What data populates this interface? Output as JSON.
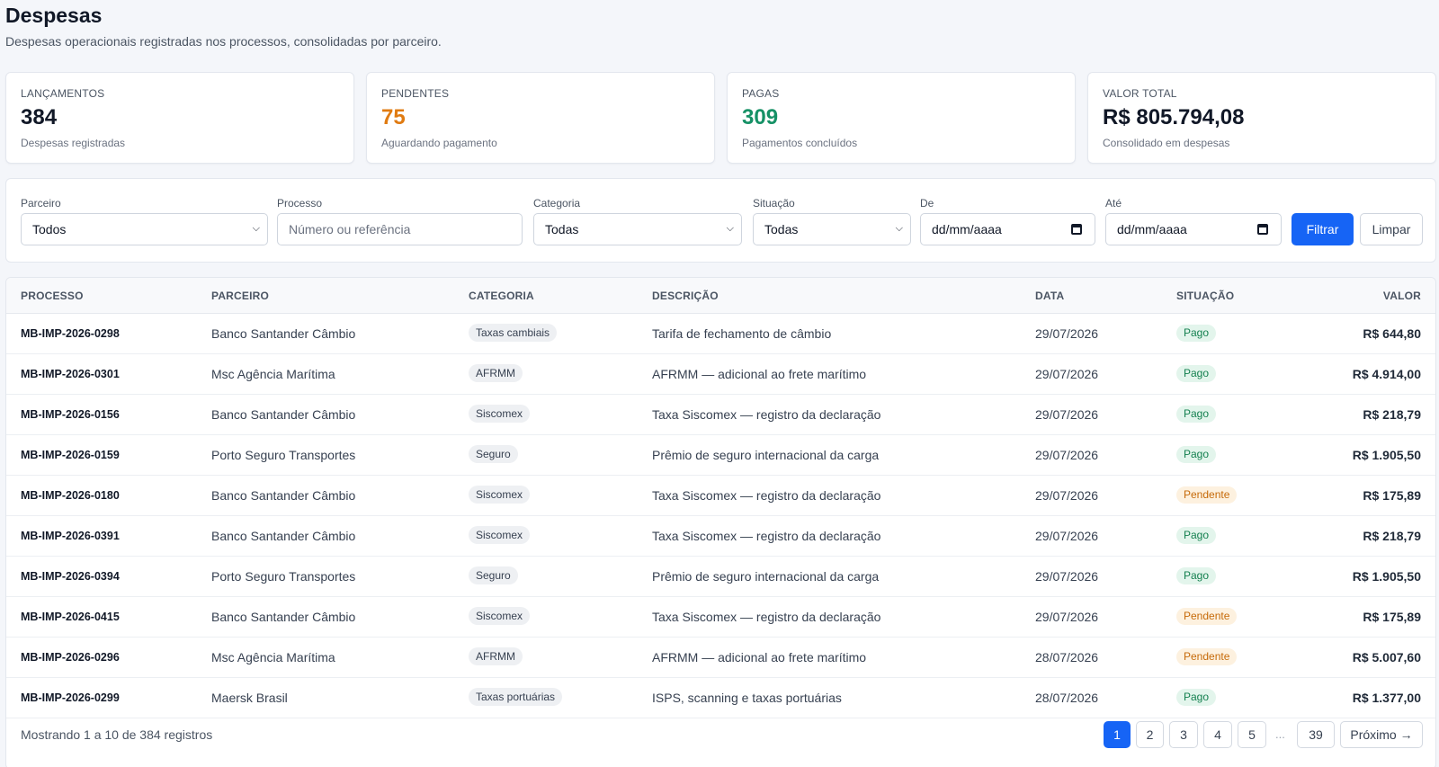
{
  "header": {
    "title": "Despesas",
    "subtitle": "Despesas operacionais registradas nos processos, consolidadas por parceiro."
  },
  "stats": [
    {
      "label": "LANÇAMENTOS",
      "value": "384",
      "hint": "Despesas registradas"
    },
    {
      "label": "PENDENTES",
      "value": "75",
      "hint": "Aguardando pagamento"
    },
    {
      "label": "PAGAS",
      "value": "309",
      "hint": "Pagamentos concluídos"
    },
    {
      "label": "VALOR TOTAL",
      "value": "R$ 805.794,08",
      "hint": "Consolidado em despesas"
    }
  ],
  "colors": {
    "accent": "#1664f5",
    "pending": "#e07b12",
    "paid": "#169166"
  },
  "filters": {
    "parceiro": {
      "label": "Parceiro",
      "value": "Todos"
    },
    "processo": {
      "label": "Processo",
      "placeholder": "Número ou referência"
    },
    "categoria": {
      "label": "Categoria",
      "value": "Todas"
    },
    "situacao": {
      "label": "Situação",
      "value": "Todas"
    },
    "de": {
      "label": "De",
      "value": "dd/mm/aaaa"
    },
    "ate": {
      "label": "Até",
      "value": "dd/mm/aaaa"
    },
    "filter_button": "Filtrar",
    "clear_button": "Limpar"
  },
  "table": {
    "columns": [
      "PROCESSO",
      "PARCEIRO",
      "CATEGORIA",
      "DESCRIÇÃO",
      "DATA",
      "SITUAÇÃO",
      "VALOR"
    ],
    "rows": [
      {
        "processo": "MB-IMP-2026-0298",
        "parceiro": "Banco Santander Câmbio",
        "categoria": "Taxas cambiais",
        "descricao": "Tarifa de fechamento de câmbio",
        "data": "29/07/2026",
        "situacao": "Pago",
        "valor": "R$ 644,80"
      },
      {
        "processo": "MB-IMP-2026-0301",
        "parceiro": "Msc Agência Marítima",
        "categoria": "AFRMM",
        "descricao": "AFRMM — adicional ao frete marítimo",
        "data": "29/07/2026",
        "situacao": "Pago",
        "valor": "R$ 4.914,00"
      },
      {
        "processo": "MB-IMP-2026-0156",
        "parceiro": "Banco Santander Câmbio",
        "categoria": "Siscomex",
        "descricao": "Taxa Siscomex — registro da declaração",
        "data": "29/07/2026",
        "situacao": "Pago",
        "valor": "R$ 218,79"
      },
      {
        "processo": "MB-IMP-2026-0159",
        "parceiro": "Porto Seguro Transportes",
        "categoria": "Seguro",
        "descricao": "Prêmio de seguro internacional da carga",
        "data": "29/07/2026",
        "situacao": "Pago",
        "valor": "R$ 1.905,50"
      },
      {
        "processo": "MB-IMP-2026-0180",
        "parceiro": "Banco Santander Câmbio",
        "categoria": "Siscomex",
        "descricao": "Taxa Siscomex — registro da declaração",
        "data": "29/07/2026",
        "situacao": "Pendente",
        "valor": "R$ 175,89"
      },
      {
        "processo": "MB-IMP-2026-0391",
        "parceiro": "Banco Santander Câmbio",
        "categoria": "Siscomex",
        "descricao": "Taxa Siscomex — registro da declaração",
        "data": "29/07/2026",
        "situacao": "Pago",
        "valor": "R$ 218,79"
      },
      {
        "processo": "MB-IMP-2026-0394",
        "parceiro": "Porto Seguro Transportes",
        "categoria": "Seguro",
        "descricao": "Prêmio de seguro internacional da carga",
        "data": "29/07/2026",
        "situacao": "Pago",
        "valor": "R$ 1.905,50"
      },
      {
        "processo": "MB-IMP-2026-0415",
        "parceiro": "Banco Santander Câmbio",
        "categoria": "Siscomex",
        "descricao": "Taxa Siscomex — registro da declaração",
        "data": "29/07/2026",
        "situacao": "Pendente",
        "valor": "R$ 175,89"
      },
      {
        "processo": "MB-IMP-2026-0296",
        "parceiro": "Msc Agência Marítima",
        "categoria": "AFRMM",
        "descricao": "AFRMM — adicional ao frete marítimo",
        "data": "28/07/2026",
        "situacao": "Pendente",
        "valor": "R$ 5.007,60"
      },
      {
        "processo": "MB-IMP-2026-0299",
        "parceiro": "Maersk Brasil",
        "categoria": "Taxas portuárias",
        "descricao": "ISPS, scanning e taxas portuárias",
        "data": "28/07/2026",
        "situacao": "Pago",
        "valor": "R$ 1.377,00"
      }
    ]
  },
  "pagination": {
    "info": "Mostrando 1 a 10 de 384 registros",
    "pages": [
      "1",
      "2",
      "3",
      "4",
      "5"
    ],
    "ellipsis": "...",
    "last_page": "39",
    "next_label": "Próximo →",
    "current": "1"
  }
}
